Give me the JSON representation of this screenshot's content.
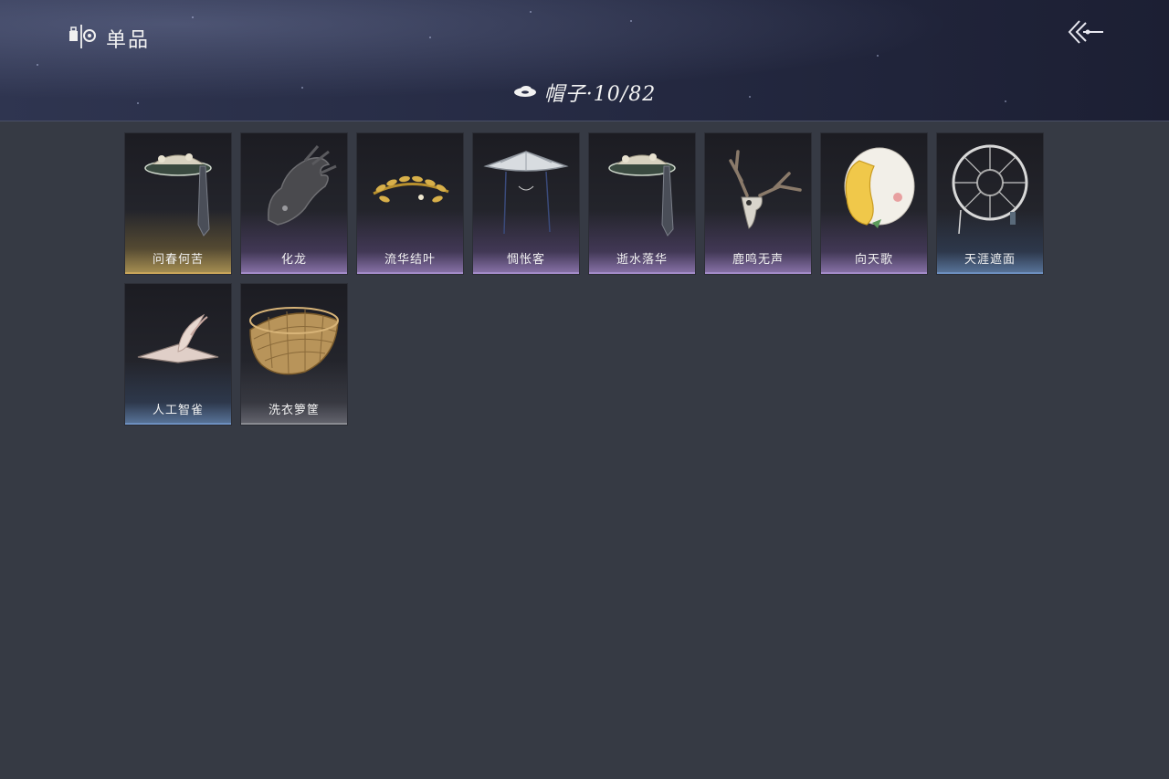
{
  "header": {
    "section_title": "单品",
    "back_icon": "back-arrow-icon",
    "section_icon": "wardrobe-icon"
  },
  "category": {
    "icon": "hat-icon",
    "label": "帽子·10/82"
  },
  "rarity_colors": {
    "gold": "#c9a55a",
    "purple": "#a38bc8",
    "blue": "#6d8fbf",
    "grey": "#8a8b92"
  },
  "items": [
    {
      "name": "问春何苦",
      "rarity": "gold",
      "icon": "veiled-straw-hat-icon"
    },
    {
      "name": "化龙",
      "rarity": "purple",
      "icon": "dragon-head-icon"
    },
    {
      "name": "流华结叶",
      "rarity": "purple",
      "icon": "golden-laurel-icon"
    },
    {
      "name": "惆怅客",
      "rarity": "purple",
      "icon": "conical-hat-icon"
    },
    {
      "name": "逝水落华",
      "rarity": "purple",
      "icon": "veiled-straw-hat-icon"
    },
    {
      "name": "鹿鸣无声",
      "rarity": "purple",
      "icon": "deer-skull-icon"
    },
    {
      "name": "向天歌",
      "rarity": "purple",
      "icon": "goose-mask-icon"
    },
    {
      "name": "天涯遮面",
      "rarity": "blue",
      "icon": "wheel-hat-icon"
    },
    {
      "name": "人工智雀",
      "rarity": "blue",
      "icon": "bird-hat-icon"
    },
    {
      "name": "洗衣箩筐",
      "rarity": "grey",
      "icon": "basket-icon"
    }
  ]
}
